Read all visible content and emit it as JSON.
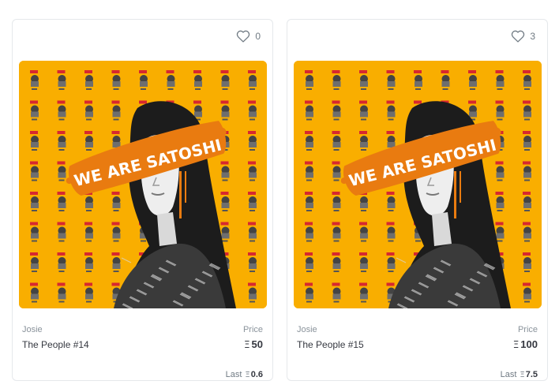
{
  "cards": [
    {
      "favorites": "0",
      "art_text": "WE ARE SATOSHI",
      "creator": "Josie",
      "title": "The People #14",
      "price_label": "Price",
      "currency_symbol": "Ξ",
      "price": "50",
      "last_label": "Last",
      "last_price": "0.6"
    },
    {
      "favorites": "3",
      "art_text": "WE ARE SATOSHI",
      "creator": "Josie",
      "title": "The People #15",
      "price_label": "Price",
      "currency_symbol": "Ξ",
      "price": "100",
      "last_label": "Last",
      "last_price": "7.5"
    }
  ],
  "colors": {
    "art_background": "#f9ae00",
    "art_brush": "#e97b10",
    "card_border": "#e5e8eb",
    "text_primary": "#353840",
    "text_muted": "#8a939b"
  },
  "icons": {
    "favorite": "heart-outline-icon"
  }
}
